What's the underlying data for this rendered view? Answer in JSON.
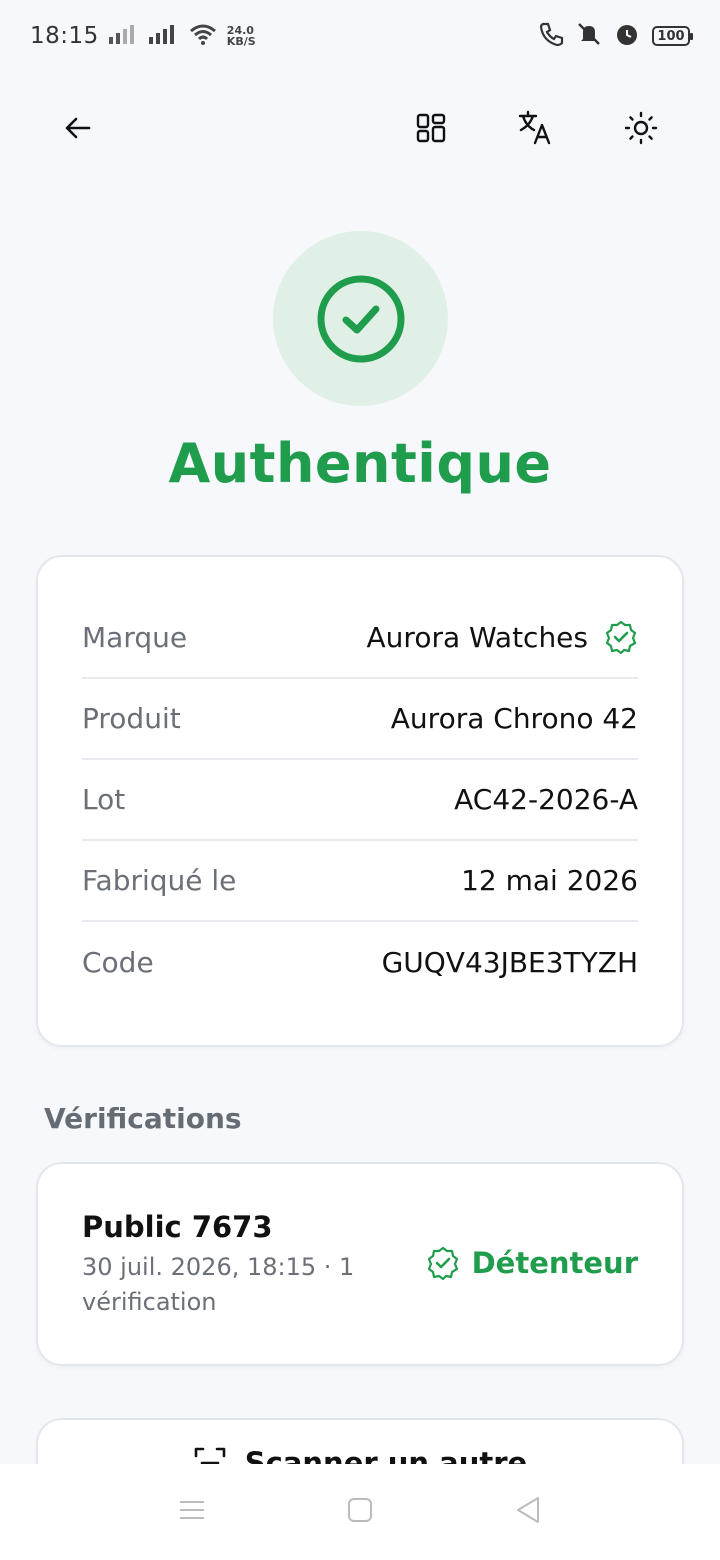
{
  "status_bar": {
    "time": "18:15",
    "speed_value": "24.0",
    "speed_unit": "KB/S",
    "battery": "100"
  },
  "toolbar": {
    "back_icon": "arrow-left-icon",
    "grid_icon": "grid-icon",
    "translate_icon": "translate-icon",
    "theme_icon": "sun-icon"
  },
  "result": {
    "title": "Authentique",
    "color": "#1f9d4c",
    "icon": "check-circle-icon"
  },
  "details": [
    {
      "label": "Marque",
      "value": "Aurora Watches",
      "verified": true
    },
    {
      "label": "Produit",
      "value": "Aurora Chrono 42"
    },
    {
      "label": "Lot",
      "value": "AC42-2026-A"
    },
    {
      "label": "Fabriqué le",
      "value": "12 mai 2026"
    },
    {
      "label": "Code",
      "value": "GUQV43JBE3TYZH"
    }
  ],
  "verifications": {
    "title": "Vérifications",
    "items": [
      {
        "name": "Public 7673",
        "meta": "30 juil. 2026, 18:15 · 1 vérification",
        "badge": "Détenteur"
      }
    ]
  },
  "scan_button": {
    "label": "Scanner un autre",
    "icon": "scan-icon"
  }
}
